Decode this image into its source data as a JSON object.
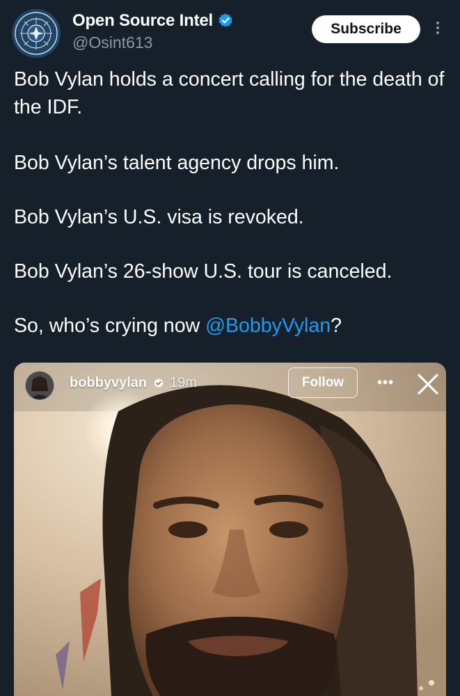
{
  "author": {
    "display_name": "Open Source Intel",
    "handle": "@Osint613",
    "verified": true,
    "avatar_icon": "osint-logo-seal"
  },
  "actions": {
    "subscribe_label": "Subscribe",
    "more_icon": "more-vertical-icon"
  },
  "tweet": {
    "paragraphs": [
      "Bob Vylan holds a concert calling for the death of the IDF.",
      "Bob Vylan’s talent agency drops him.",
      "Bob Vylan’s U.S. visa is revoked.",
      "Bob Vylan’s 26-show U.S. tour is canceled."
    ],
    "last_line_prefix": "So, who’s crying now ",
    "mention": "@BobbyVylan",
    "last_line_suffix": "?"
  },
  "embedded_story": {
    "username": "bobbyvylan",
    "verified": true,
    "time_ago": "19m",
    "follow_label": "Follow",
    "more_label": "•••",
    "close_icon": "close-icon"
  },
  "colors": {
    "background": "#15202b",
    "text": "#ffffff",
    "secondary_text": "#8b98a5",
    "link": "#1d9bf0",
    "verified": "#1d9bf0"
  }
}
